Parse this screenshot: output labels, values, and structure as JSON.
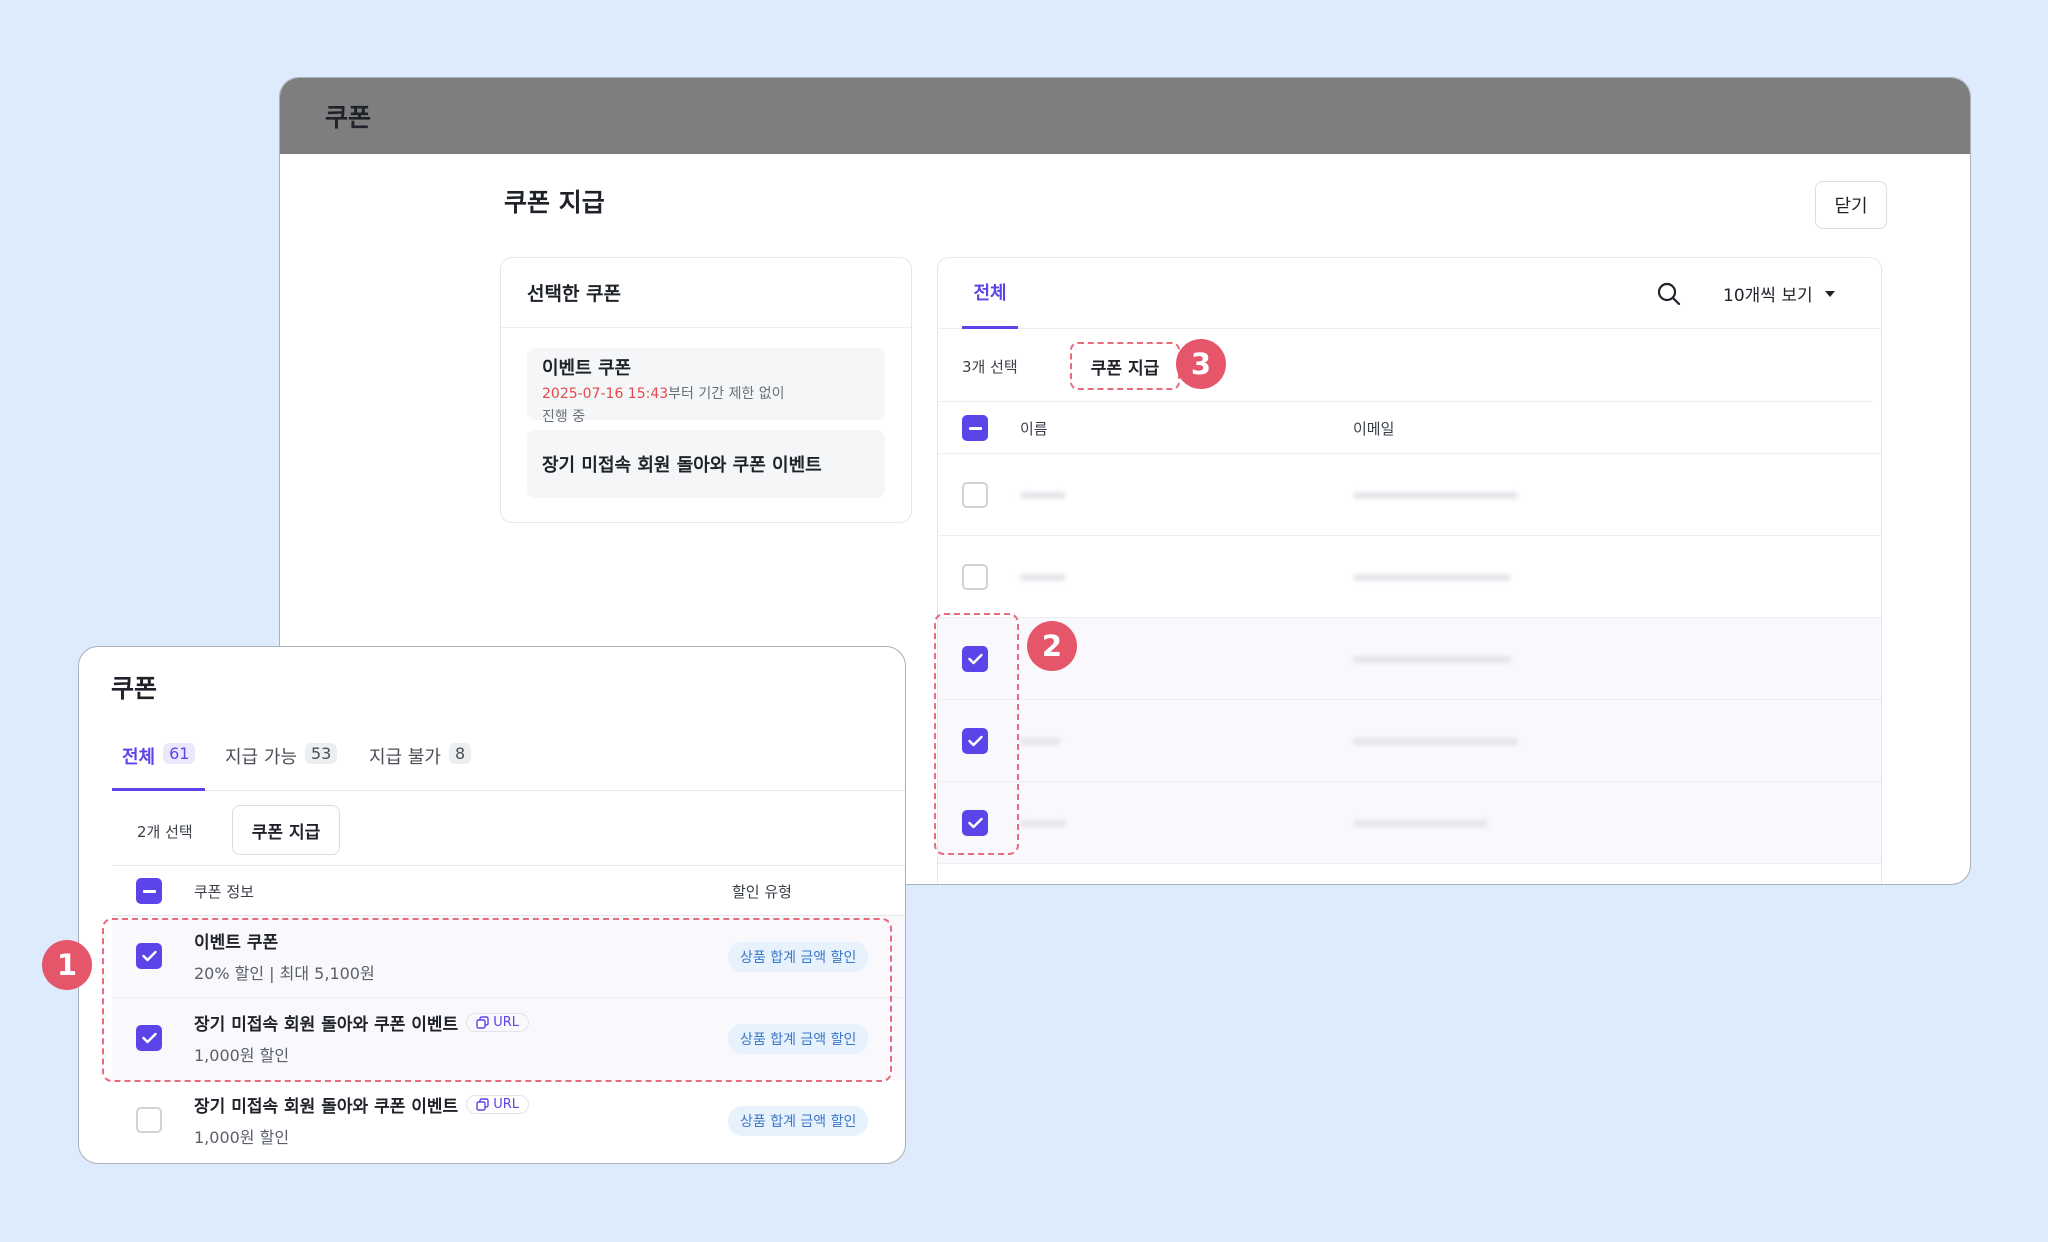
{
  "window": {
    "title": "쿠폰",
    "page_title": "쿠폰 지급",
    "close_label": "닫기"
  },
  "selected_coupons": {
    "header": "선택한 쿠폰",
    "items": [
      {
        "title": "이벤트 쿠폰",
        "date": "2025-07-16 15:43",
        "date_suffix": "부터 기간 제한 없이",
        "status": "진행 중"
      },
      {
        "title": "장기 미접속 회원 돌아와 쿠폰 이벤트"
      }
    ]
  },
  "users_panel": {
    "tab": "전체",
    "per_page": "10개씩 보기",
    "selected_count": "3개 선택",
    "issue_button": "쿠폰 지급",
    "columns": {
      "name": "이름",
      "email": "이메일"
    },
    "rows": [
      {
        "checked": false
      },
      {
        "checked": false
      },
      {
        "checked": true
      },
      {
        "checked": true
      },
      {
        "checked": true
      }
    ]
  },
  "coupon_popup": {
    "title": "쿠폰",
    "tabs": [
      {
        "label": "전체",
        "count": "61",
        "active": true
      },
      {
        "label": "지급 가능",
        "count": "53",
        "active": false
      },
      {
        "label": "지급 불가",
        "count": "8",
        "active": false
      }
    ],
    "selected_count": "2개 선택",
    "issue_button": "쿠폰 지급",
    "columns": {
      "info": "쿠폰 정보",
      "type": "할인 유형"
    },
    "rows": [
      {
        "title": "이벤트 쿠폰",
        "sub": "20% 할인 | 최대 5,100원",
        "type": "상품 합계 금액 할인",
        "checked": true
      },
      {
        "title": "장기 미접속 회원 돌아와 쿠폰 이벤트",
        "url": "URL",
        "sub": "1,000원 할인",
        "type": "상품 합계 금액 할인",
        "checked": true
      },
      {
        "title": "장기 미접속 회원 돌아와 쿠폰 이벤트",
        "url": "URL",
        "sub": "1,000원 할인",
        "type": "상품 합계 금액 할인",
        "checked": false
      }
    ]
  },
  "callouts": [
    "1",
    "2",
    "3"
  ],
  "colors": {
    "accent": "#5b45e8",
    "callout": "#e5566b",
    "background": "#deebfd"
  }
}
